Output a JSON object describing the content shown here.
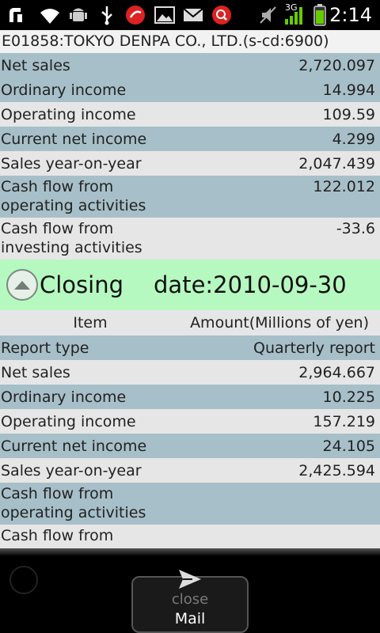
{
  "status_bar": {
    "time": "2:14",
    "network": "3G",
    "icons": [
      "notification-icon",
      "wifi-icon",
      "android-icon",
      "usb-icon",
      "app-icon",
      "image-icon",
      "mail-icon",
      "search-icon",
      "mute-icon",
      "signal-icon",
      "battery-icon"
    ]
  },
  "header": {
    "title": "E01858:TOKYO DENPA CO., LTD.(s-cd:6900)"
  },
  "section1": {
    "rows": [
      {
        "label": "Net sales",
        "value": "2,720.097"
      },
      {
        "label": "Ordinary income",
        "value": "14.994"
      },
      {
        "label": "Operating income",
        "value": "109.59"
      },
      {
        "label": "Current net income",
        "value": "4.299"
      },
      {
        "label": "Sales year-on-year",
        "value": "2,047.439"
      },
      {
        "label": "Cash flow from\noperating activities",
        "value": "122.012"
      },
      {
        "label": "Cash flow from\ninvesting activities",
        "value": "-33.6"
      }
    ]
  },
  "closing": {
    "label": "Closing",
    "date": "date:2010-09-30"
  },
  "table": {
    "col_item": "Item",
    "col_amount": "Amount(Millions of yen)"
  },
  "section2": {
    "rows": [
      {
        "label": "Report type",
        "value": "Quarterly report"
      },
      {
        "label": "Net sales",
        "value": "2,964.667"
      },
      {
        "label": "Ordinary income",
        "value": "10.225"
      },
      {
        "label": "Operating income",
        "value": "157.219"
      },
      {
        "label": "Current net income",
        "value": "24.105"
      },
      {
        "label": "Sales year-on-year",
        "value": "2,425.594"
      },
      {
        "label": "Cash flow from\noperating activities",
        "value": ""
      },
      {
        "label": "Cash flow from\ninvesting activities",
        "value": ""
      }
    ]
  },
  "bottom_bar": {
    "close_label": "close",
    "mail_label": "Mail"
  },
  "colors": {
    "row_even": "#e6e6e6",
    "row_odd": "#a7bfc8",
    "closing_bg": "#b6f9c0"
  }
}
